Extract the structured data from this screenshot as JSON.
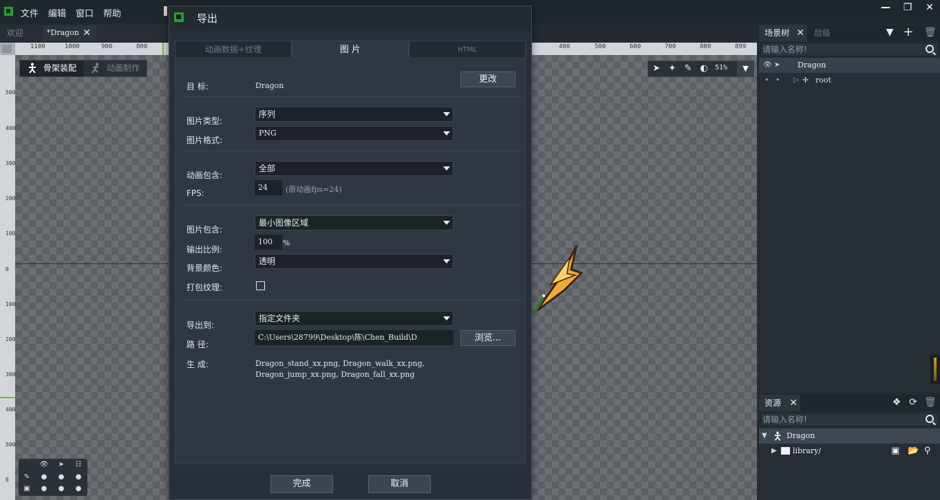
{
  "menubar": {
    "items": [
      "文件",
      "编辑",
      "窗口",
      "帮助"
    ],
    "window_controls": [
      "minimize",
      "restore",
      "close"
    ]
  },
  "doc_tabs": {
    "welcome": "欢迎",
    "dragon": "*Dragon"
  },
  "ruler": {
    "top_ticks": [
      "1100",
      "1000",
      "900",
      "800",
      "400",
      "500",
      "600",
      "700",
      "800",
      "899"
    ],
    "left_ticks": [
      "500",
      "400",
      "300",
      "200",
      "100",
      "0",
      "100",
      "200",
      "300",
      "400",
      "500",
      "6"
    ]
  },
  "mode_switch": {
    "armature": "骨架装配",
    "animate": "动画制作"
  },
  "canvas_tools": {
    "zoom": "51%"
  },
  "scene_panel": {
    "tab_scene": "场景树",
    "tab_layers": "层级",
    "search_placeholder": "请输入名称!",
    "tree": [
      {
        "label": "Dragon"
      },
      {
        "label": "root"
      }
    ]
  },
  "asset_panel": {
    "tab": "资源",
    "search_placeholder": "请输入名称!",
    "tree": [
      {
        "label": "Dragon"
      },
      {
        "label": "library/"
      }
    ]
  },
  "dialog": {
    "title": "导出",
    "tabs": [
      "动画数据+纹理",
      "图 片",
      "HTML"
    ],
    "target_label": "目  标:",
    "target_value": "Dragon",
    "change_button": "更改",
    "image_type_label": "图片类型:",
    "image_type": "序列",
    "image_format_label": "图片格式:",
    "image_format": "PNG",
    "anim_include_label": "动画包含:",
    "anim_include": "全部",
    "fps_label": "FPS:",
    "fps_value": "24",
    "fps_hint": "(原动画fps=24)",
    "image_include_label": "图片包含:",
    "image_include": "最小图像区域",
    "scale_label": "输出比例:",
    "scale_value": "100",
    "scale_unit": "%",
    "bg_color_label": "背景颜色:",
    "bg_color": "透明",
    "pack_label": "打包纹理:",
    "pack_checked": false,
    "export_to_label": "导出到:",
    "export_to": "指定文件夹",
    "path_label": "路  径:",
    "path_value": "C:\\Users\\28799\\Desktop\\陈\\Chen_Build\\D",
    "browse_button": "浏览...",
    "generate_label": "生  成:",
    "generate_line1": "Dragon_stand_xx.png, Dragon_walk_xx.png,",
    "generate_line2": "Dragon_jump_xx.png, Dragon_fall_xx.png",
    "ok_button": "完成",
    "cancel_button": "取消"
  },
  "colors": {
    "accent_green": "#2f9a38",
    "dialog_bg": "#27303a",
    "panel_bg": "#262d35"
  }
}
